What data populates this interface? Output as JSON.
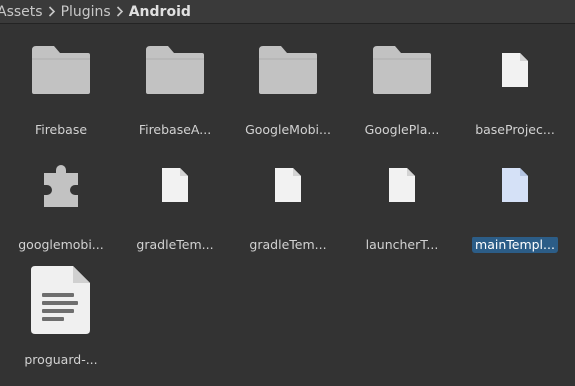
{
  "breadcrumb": {
    "items": [
      "Assets",
      "Plugins",
      "Android"
    ]
  },
  "colors": {
    "background": "#333333",
    "folder": "#c2c2c2",
    "file": "#f2f2f2",
    "selected_file": "#d5e1f7",
    "selection": "#2c5d87"
  },
  "items": [
    {
      "label": "Firebase",
      "icon": "folder-icon"
    },
    {
      "label": "FirebaseA...",
      "icon": "folder-icon"
    },
    {
      "label": "GoogleMobi...",
      "icon": "folder-icon"
    },
    {
      "label": "GooglePla...",
      "icon": "folder-icon"
    },
    {
      "label": "baseProjec...",
      "icon": "file-icon"
    },
    {
      "label": "googlemobi...",
      "icon": "plugin-icon"
    },
    {
      "label": "gradleTem...",
      "icon": "file-icon"
    },
    {
      "label": "gradleTem...",
      "icon": "file-icon"
    },
    {
      "label": "launcherT...",
      "icon": "file-icon"
    },
    {
      "label": "mainTempl...",
      "icon": "file-icon",
      "selected": true
    },
    {
      "label": "proguard-...",
      "icon": "text-file-icon"
    }
  ]
}
